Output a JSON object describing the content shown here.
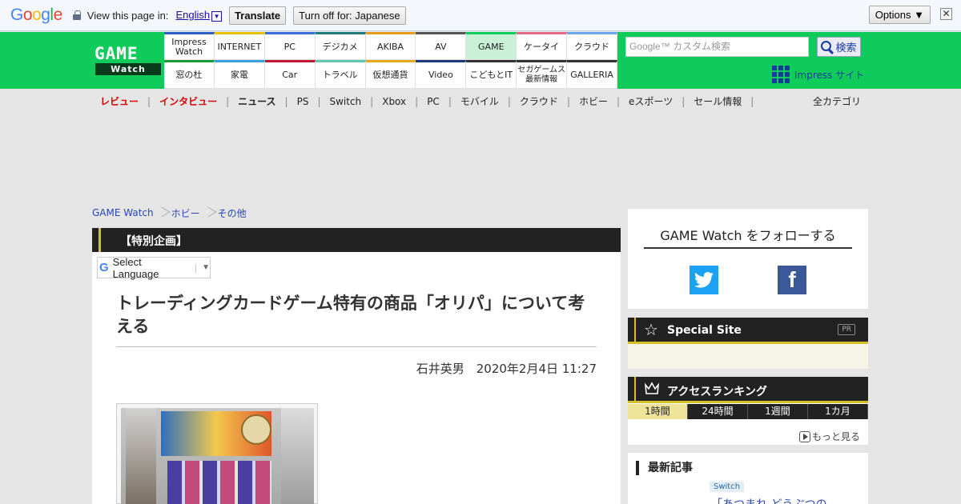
{
  "translate_bar": {
    "brand_letters": [
      "G",
      "o",
      "o",
      "g",
      "l",
      "e"
    ],
    "view_text": "View this page in:",
    "language": "English",
    "translate_label": "Translate",
    "turn_off_label": "Turn off for: Japanese",
    "options_label": "Options ▼",
    "close_label": "✕"
  },
  "header": {
    "logo_top": "GAME",
    "logo_bottom": "Watch",
    "nav_top": [
      "Impress Watch",
      "INTERNET",
      "PC",
      "デジカメ",
      "AKIBA",
      "AV",
      "GAME",
      "ケータイ",
      "クラウド"
    ],
    "nav_bottom": [
      "窓の杜",
      "家電",
      "Car",
      "トラベル",
      "仮想通貨",
      "Video",
      "こどもとIT",
      "セガゲームス 最新情報",
      "GALLERIA"
    ],
    "nav_top_colors": [
      "#2f5fc4",
      "#e8c000",
      "#3a6ed8",
      "#1f7a7a",
      "#e99a1c",
      "#555555",
      "#0fcc5a",
      "#e46a86",
      "#6aa6e8"
    ],
    "nav_bottom_colors": [
      "#1b9a3a",
      "#3aa0e0",
      "#c4162e",
      "#5fc8b0",
      "#e8a81c",
      "#1f3a7a",
      "#333333",
      "#333333",
      "#333333"
    ],
    "search_placeholder": "Google™ カスタム検索",
    "search_button": "検索",
    "impress_site": "Impress サイト"
  },
  "subnav": {
    "items": [
      "レビュー",
      "インタビュー",
      "ニュース",
      "PS",
      "Switch",
      "Xbox",
      "PC",
      "モバイル",
      "クラウド",
      "ホビー",
      "eスポーツ",
      "セール情報"
    ],
    "all_categories": "全カテゴリ"
  },
  "breadcrumb": [
    "GAME Watch",
    "ホビー",
    "その他"
  ],
  "article": {
    "section": "【特別企画】",
    "select_language": "Select Language",
    "title": "トレーディングカードゲーム特有の商品「オリパ」について考える",
    "author": "石井英男",
    "date": "2020年2月4日 11:27"
  },
  "sidebar": {
    "follow_title": "GAME Watch をフォローする",
    "special_site": "Special Site",
    "pr": "PR",
    "ranking_title": "アクセスランキング",
    "ranking_tabs": [
      "1時間",
      "24時間",
      "1週間",
      "1カ月"
    ],
    "more": "もっと見る",
    "latest_title": "最新記事",
    "latest_tag": "Switch",
    "latest_article": "「あつまれ どうぶつの"
  }
}
